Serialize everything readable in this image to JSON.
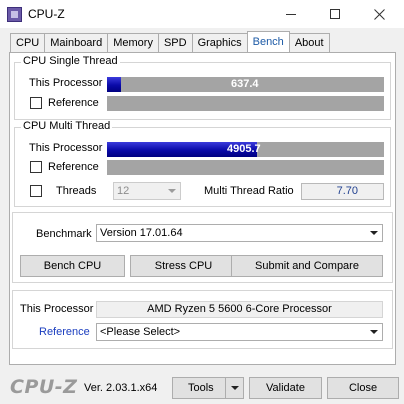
{
  "window": {
    "title": "CPU-Z"
  },
  "tabs": [
    {
      "label": "CPU"
    },
    {
      "label": "Mainboard"
    },
    {
      "label": "Memory"
    },
    {
      "label": "SPD"
    },
    {
      "label": "Graphics"
    },
    {
      "label": "Bench"
    },
    {
      "label": "About"
    }
  ],
  "active_tab": "Bench",
  "single_thread": {
    "title": "CPU Single Thread",
    "this_processor_label": "This Processor",
    "this_processor_value": "637.4",
    "this_processor_fill": 0.05,
    "reference_label": "Reference"
  },
  "multi_thread": {
    "title": "CPU Multi Thread",
    "this_processor_label": "This Processor",
    "this_processor_value": "4905.7",
    "this_processor_fill": 0.54,
    "reference_label": "Reference",
    "threads_label": "Threads",
    "threads_value": "12",
    "ratio_label": "Multi Thread Ratio",
    "ratio_value": "7.70"
  },
  "benchmark": {
    "label": "Benchmark",
    "version_value": "Version 17.01.64",
    "bench_cpu_label": "Bench CPU",
    "stress_cpu_label": "Stress CPU",
    "submit_label": "Submit and Compare"
  },
  "processor_info": {
    "this_processor_label": "This Processor",
    "this_processor_value": "AMD Ryzen 5 5600 6-Core Processor",
    "reference_label": "Reference",
    "reference_value": "<Please Select>"
  },
  "footer": {
    "logo": "CPU-Z",
    "version": "Ver. 2.03.1.x64",
    "tools_label": "Tools",
    "validate_label": "Validate",
    "close_label": "Close"
  },
  "colors": {
    "bar_fill": "#0a0aa8",
    "bar_track": "#a4a4a4",
    "active_tab_text": "#1c5aa6",
    "link_text": "#1a3dbf"
  }
}
